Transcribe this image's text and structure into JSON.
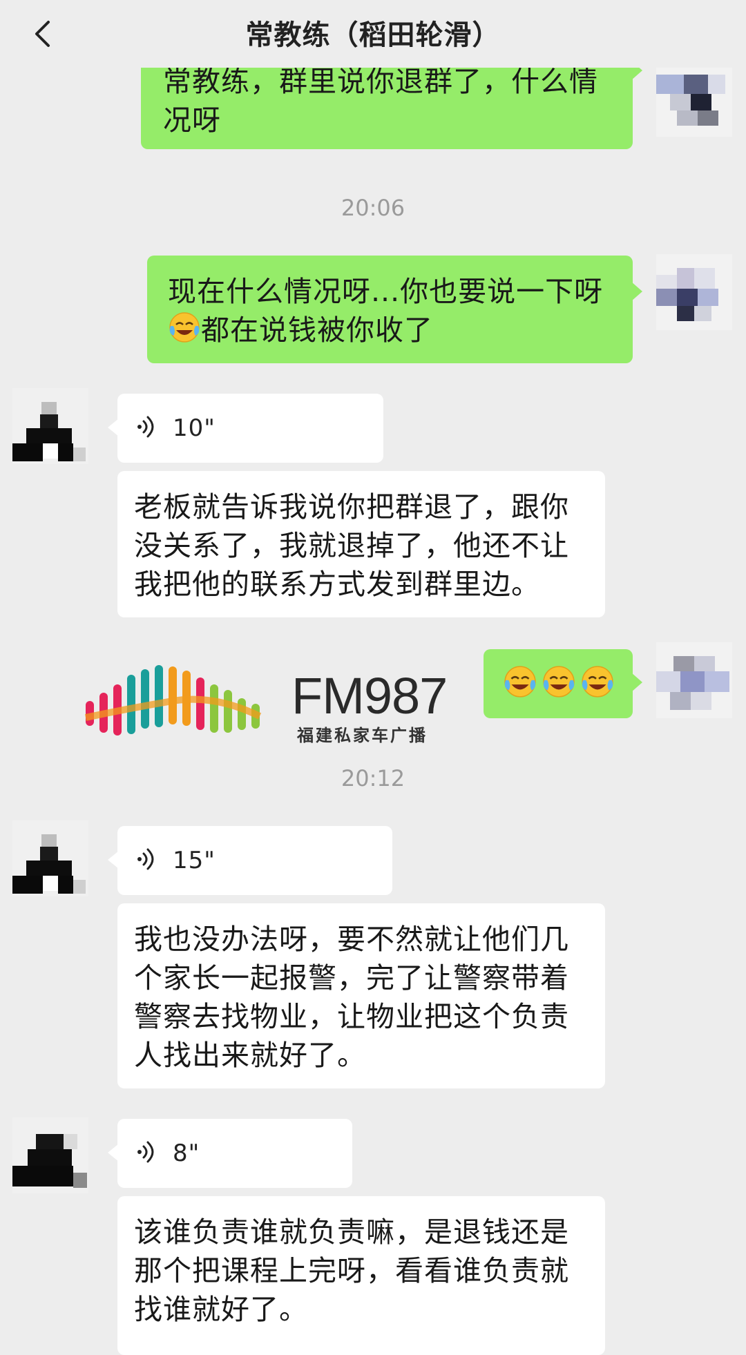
{
  "header": {
    "title": "常教练（稻田轮滑）",
    "back_icon": "chevron-left-icon"
  },
  "messages": {
    "m1": {
      "side": "outgoing",
      "text_line1": "常教练，群里说你退群了，什么情",
      "text_line2": "况呀"
    },
    "time1": "20:06",
    "m2": {
      "side": "outgoing",
      "text_line1": "现在什么情况呀...你也要说一下呀",
      "text_line2": "都在说钱被你收了",
      "emoji": "crying-laughing-emoji"
    },
    "m3": {
      "side": "incoming",
      "type": "voice",
      "duration": "10\""
    },
    "m4": {
      "side": "incoming",
      "text_line1": "老板就告诉我说你把群退了，跟你",
      "text_line2": "没关系了，我就退掉了，他还不让",
      "text_line3": "我把他的联系方式发到群里边。"
    },
    "m5": {
      "side": "outgoing",
      "emoji_count": 3,
      "emoji": "crying-laughing-emoji"
    },
    "time2": "20:12",
    "m6": {
      "side": "incoming",
      "type": "voice",
      "duration": "15\""
    },
    "m7": {
      "side": "incoming",
      "text_line1": "我也没办法呀，要不然就让他们几",
      "text_line2": "个家长一起报警，完了让警察带着",
      "text_line3": "警察去找物业，让物业把这个负责",
      "text_line4": "人找出来就好了。"
    },
    "m8": {
      "side": "incoming",
      "type": "voice",
      "duration": "8\""
    },
    "m9": {
      "side": "incoming",
      "text_line1": "该谁负责谁就负责嘛，是退钱还是",
      "text_line2": "那个把课程上完呀，看看谁负责就",
      "text_line3": "找谁就好了。"
    }
  },
  "watermark": {
    "logo_text": "FM987",
    "subtitle": "福建私家车广播"
  },
  "colors": {
    "background": "#ededed",
    "outgoing_bubble": "#95ec69",
    "incoming_bubble": "#ffffff",
    "timestamp": "#9a9a9a"
  }
}
